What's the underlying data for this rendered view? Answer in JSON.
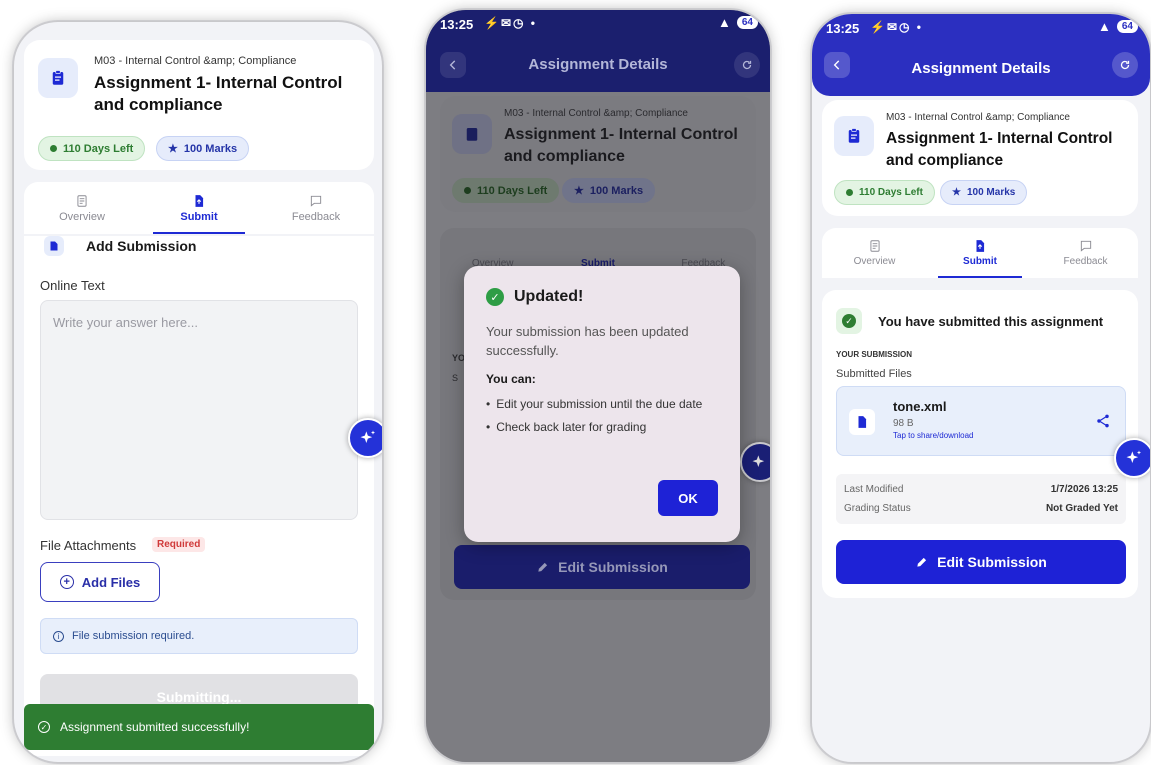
{
  "course": "M03 - Internal Control &amp; Compliance",
  "title_line1": "Assignment 1- Internal Control",
  "title_line2": "and compliance",
  "days_left": "110 Days Left",
  "marks": "100 Marks",
  "tabs": {
    "overview": "Overview",
    "submit": "Submit",
    "feedback": "Feedback"
  },
  "status": {
    "time": "13:25",
    "battery": "64"
  },
  "header_title": "Assignment Details",
  "screen1": {
    "section_title": "Add Submission",
    "online_text_label": "Online Text",
    "textarea_placeholder": "Write your answer here...",
    "attachments_label": "File Attachments",
    "required_badge": "Required",
    "add_files": "Add Files",
    "info_text": "File submission required.",
    "submitting": "Submitting...",
    "toast": "Assignment submitted successfully!"
  },
  "screen2": {
    "dialog_title": "Updated!",
    "dialog_message": "Your submission has been updated successfully.",
    "you_can": "You can:",
    "bullets": [
      "Edit your submission until the due date",
      "Check back later for grading"
    ],
    "ok": "OK",
    "edit_submission": "Edit Submission",
    "bg_you": "YO",
    "bg_s": "S"
  },
  "screen3": {
    "submitted_banner": "You have submitted this assignment",
    "your_submission": "YOUR SUBMISSION",
    "submitted_files": "Submitted Files",
    "file_name": "tone.xml",
    "file_size": "98 B",
    "file_hint": "Tap to share/download",
    "last_modified_label": "Last Modified",
    "last_modified_value": "1/7/2026 13:25",
    "grading_status_label": "Grading Status",
    "grading_status_value": "Not Graded Yet",
    "edit_submission": "Edit Submission"
  },
  "colors": {
    "primary": "#1e22d6",
    "header": "#2b2fc0",
    "success": "#2e7d32"
  }
}
